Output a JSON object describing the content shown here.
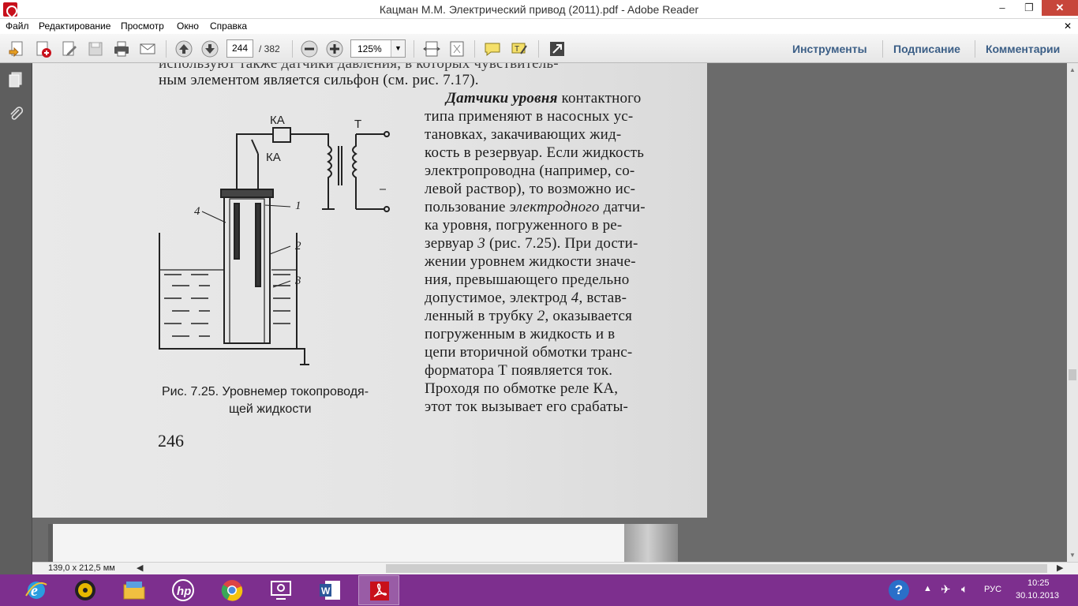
{
  "window": {
    "title": "Кацман М.М. Электрический привод (2011).pdf - Adobe Reader",
    "min": "–",
    "max": "❐",
    "close": "✕"
  },
  "menu": {
    "items": [
      "Файл",
      "Редактирование",
      "Просмотр",
      "Окно",
      "Справка"
    ],
    "close_doc": "✕"
  },
  "toolbar": {
    "page_current": "244",
    "page_total": "/ 382",
    "zoom": "125%",
    "right_tabs": [
      "Инструменты",
      "Подписание",
      "Комментарии"
    ]
  },
  "document": {
    "top_partial": "используют также датчики давления, в которых чувствитель-",
    "line_intro": "ным элементом является сильфон (см. рис. 7.17).",
    "lines": [
      "контактного",
      "типа применяют в насосных ус-",
      "тановках, закачивающих жид-",
      "кость в резервуар. Если жидкость",
      "электропроводна (например, со-",
      "левой раствор), то возможно ис-",
      "ка уровня, погруженного в ре-",
      "зервуар",
      "(рис. 7.25). При дости-",
      "жении уровнем жидкости значе-",
      "ния, превышающего предельно",
      "допустимое, электрод",
      ", встав-",
      "ленный в трубку",
      ", оказывается",
      "погруженным в жидкость и в",
      "цепи вторичной обмотки транс-",
      "форматора Т появляется ток.",
      "Проходя по обмотке реле КА,",
      "этот ток вызывает его срабаты-"
    ],
    "heading_bold": "Датчики уровня",
    "line7_prefix": "пользование",
    "line7_italic": "электродного",
    "line7_suffix": "датчи-",
    "num3": "3",
    "num4": "4",
    "num2": "2",
    "figure": {
      "label_ka_top": "КА",
      "label_ka_mid": "КА",
      "label_t": "Т",
      "num_4": "4",
      "num_1": "1",
      "num_2": "2",
      "num_3": "3"
    },
    "caption_line1": "Рис. 7.25. Уровнемер токопроводя-",
    "caption_line2": "щей жидкости",
    "page_number": "246"
  },
  "status": {
    "dimensions": "139,0 x 212,5 мм"
  },
  "taskbar": {
    "clock_time": "10:25",
    "clock_date": "30.10.2013",
    "lang": "РУС"
  },
  "colors": {
    "taskbar": "#7d2f8e",
    "accent_tab": "#3b5e86",
    "close": "#c7463b"
  }
}
